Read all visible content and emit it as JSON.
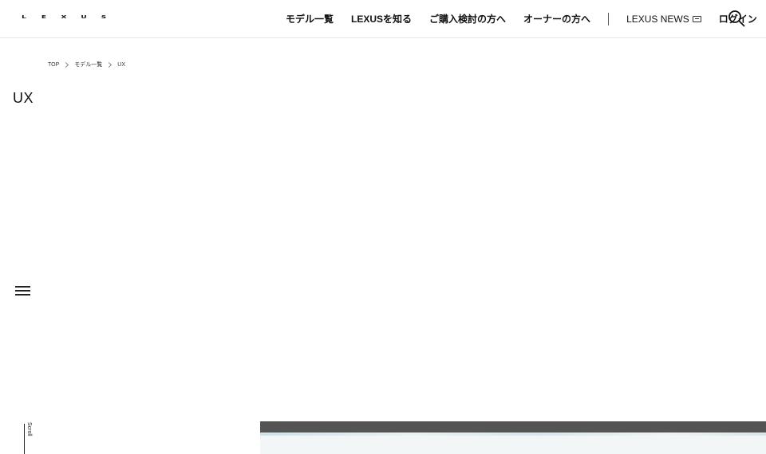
{
  "header": {
    "logo_letters": [
      "L",
      "E",
      "X",
      "U",
      "S"
    ],
    "nav": [
      {
        "label": "モデル一覧"
      },
      {
        "label": "LEXUSを知る"
      },
      {
        "label": "ご購入検討の方へ"
      },
      {
        "label": "オーナーの方へ"
      }
    ],
    "news_label": "LEXUS NEWS",
    "login_label": "ログイン",
    "search_icon": "search-icon"
  },
  "breadcrumb": {
    "items": [
      "TOP",
      "モデル一覧",
      "UX"
    ]
  },
  "page": {
    "title": "UX"
  },
  "side": {
    "menu_icon": "hamburger-menu-icon",
    "scroll_label": "Scroll"
  },
  "colors": {
    "text": "#111111",
    "border": "#e6e6e6",
    "hero_dark": "#545454"
  }
}
